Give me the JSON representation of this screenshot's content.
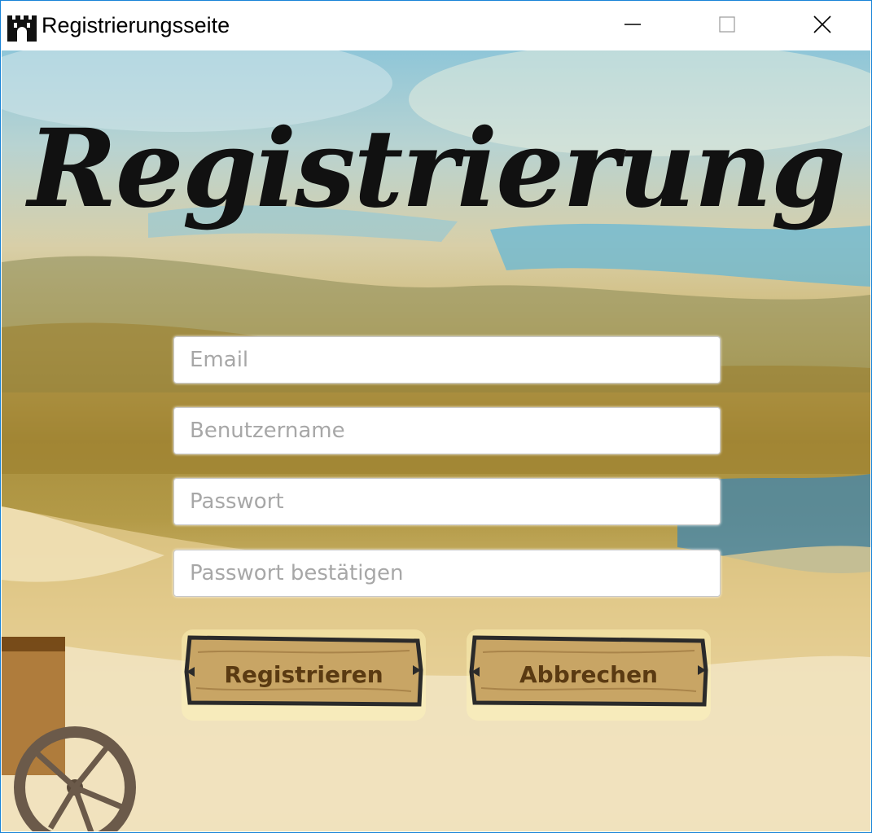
{
  "window": {
    "title": "Registrierungsseite",
    "icon": "castle-icon",
    "controls": {
      "minimize": "minimize-icon",
      "maximize": "maximize-icon",
      "close": "close-icon"
    }
  },
  "page": {
    "heading": "Registrierung"
  },
  "form": {
    "email": {
      "placeholder": "Email",
      "value": ""
    },
    "username": {
      "placeholder": "Benutzername",
      "value": ""
    },
    "password": {
      "placeholder": "Passwort",
      "value": ""
    },
    "password_confirm": {
      "placeholder": "Passwort bestätigen",
      "value": ""
    }
  },
  "buttons": {
    "register": "Registrieren",
    "cancel": "Abbrechen"
  },
  "colors": {
    "window_border": "#1883d7",
    "button_wood": "#c8a565",
    "button_text": "#5a3a12",
    "heading": "#111111"
  }
}
